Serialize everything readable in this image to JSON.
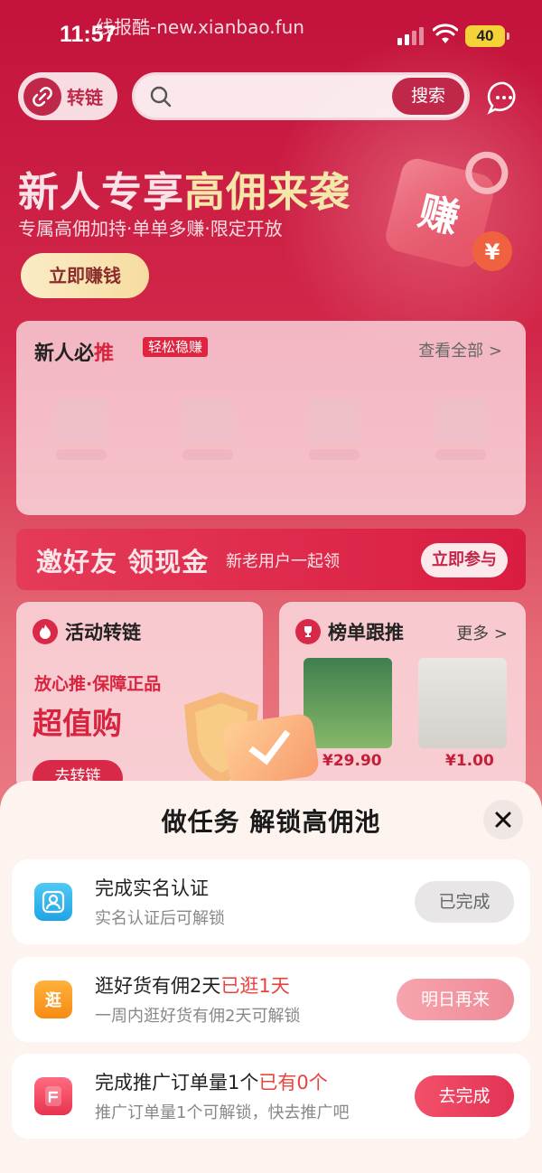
{
  "status_bar": {
    "time": "11:57",
    "watermark": "线报酷-new.xianbao.fun",
    "battery": "40"
  },
  "header": {
    "convert_label": "转链",
    "search_placeholder": "",
    "search_button": "搜索"
  },
  "banner": {
    "title_part1": "新人专享",
    "title_part2": "高佣来袭",
    "subtitle": "专属高佣加持·单单多赚·限定开放",
    "cta": "立即赚钱",
    "tag_char": "赚",
    "coin_char": "¥"
  },
  "new_user_section": {
    "title_prefix": "新人必",
    "title_highlight": "推",
    "chip": "轻松稳赚",
    "more": "查看全部 >"
  },
  "invite": {
    "headline": "邀好友 领现金",
    "sub": "新老用户一起领",
    "button": "立即参与"
  },
  "activity_card": {
    "title": "活动转链",
    "line1": "放心推·保障正品",
    "line2": "超值购",
    "button": "去转链"
  },
  "ranking_card": {
    "title": "榜单跟推",
    "more": "更多 >",
    "products": [
      {
        "price": "¥29.90"
      },
      {
        "price": "¥1.00"
      }
    ]
  },
  "sheet": {
    "title": "做任务 解锁高佣池",
    "tasks": [
      {
        "title": "完成实名认证",
        "title_red": "",
        "subtitle": "实名认证后可解锁",
        "button": "已完成"
      },
      {
        "title": "逛好货有佣2天",
        "title_red": "已逛1天",
        "subtitle": "一周内逛好货有佣2天可解锁",
        "button": "明日再来",
        "icon_char": "逛"
      },
      {
        "title": "完成推广订单量1个",
        "title_red": "已有0个",
        "subtitle": "推广订单量1个可解锁，快去推广吧",
        "button": "去完成"
      }
    ]
  },
  "colors": {
    "brand": "#c0284a",
    "highlight_red": "#e8433f",
    "sheet_bg": "#fdf3ef"
  }
}
